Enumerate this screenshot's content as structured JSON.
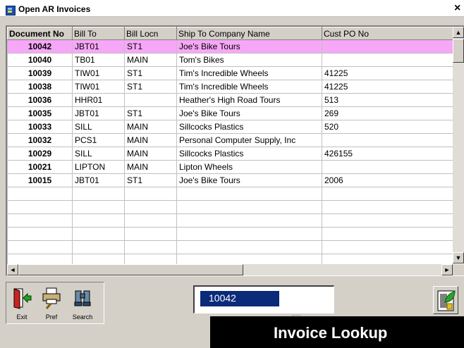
{
  "window": {
    "title": "Open AR Invoices",
    "close_glyph": "×"
  },
  "grid": {
    "columns": [
      "Document No",
      "Bill To",
      "Bill Locn",
      "Ship To Company Name",
      "Cust PO No"
    ],
    "rows": [
      [
        "10042",
        "JBT01",
        "ST1",
        "Joe's Bike Tours",
        ""
      ],
      [
        "10040",
        "TB01",
        "MAIN",
        "Tom's Bikes",
        ""
      ],
      [
        "10039",
        "TIW01",
        "ST1",
        "Tim's Incredible Wheels",
        "41225"
      ],
      [
        "10038",
        "TIW01",
        "ST1",
        "Tim's Incredible Wheels",
        "41225"
      ],
      [
        "10036",
        "HHR01",
        "",
        "Heather's High Road Tours",
        "513"
      ],
      [
        "10035",
        "JBT01",
        "ST1",
        "Joe's Bike Tours",
        "269"
      ],
      [
        "10033",
        "SILL",
        "MAIN",
        "Sillcocks Plastics",
        "520"
      ],
      [
        "10032",
        "PCS1",
        "MAIN",
        "Personal Computer Supply, Inc",
        ""
      ],
      [
        "10029",
        "SILL",
        "MAIN",
        "Sillcocks Plastics",
        "426155"
      ],
      [
        "10021",
        "LIPTON",
        "MAIN",
        "Lipton Wheels",
        ""
      ],
      [
        "10015",
        "JBT01",
        "ST1",
        "Joe's Bike Tours",
        "2006"
      ]
    ],
    "selected_row": 0,
    "selected_color": "#f7a7f7"
  },
  "scroll": {
    "up": "▲",
    "down": "▼",
    "left": "◄",
    "right": "►"
  },
  "toolbar": {
    "exit_label": "Exit",
    "exit_icon": "exit-door-icon",
    "pref_label": "Pref",
    "pref_icon": "printer-preferences-icon",
    "search_label": "Search",
    "search_icon": "binoculars-icon"
  },
  "lookup": {
    "value": "10042"
  },
  "banner": {
    "text": "Invoice Lookup"
  }
}
